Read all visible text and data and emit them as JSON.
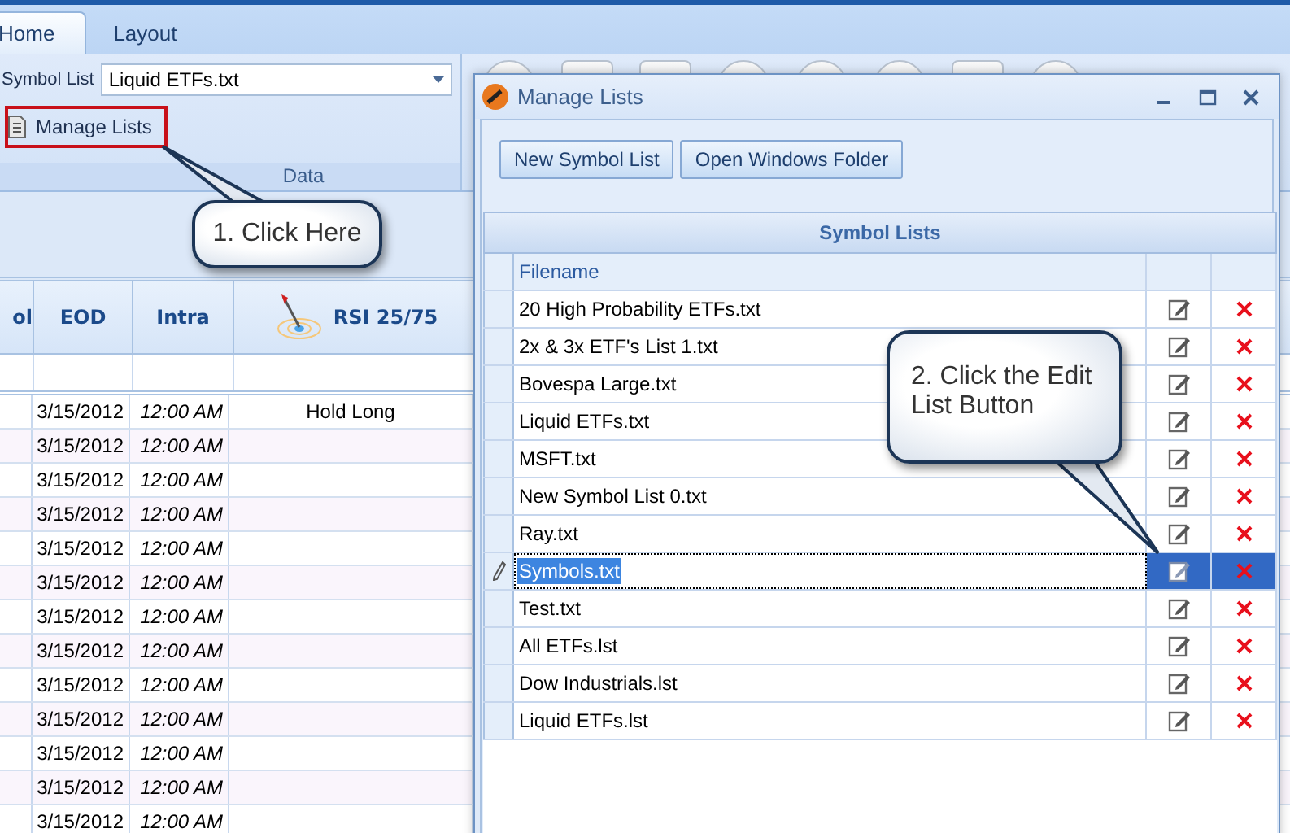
{
  "tabs": [
    {
      "label": "Home",
      "selected": true
    },
    {
      "label": "Layout",
      "selected": false
    }
  ],
  "ribbon": {
    "symbol_list_label": "Symbol List",
    "symbol_list_value": "Liquid ETFs.txt",
    "manage_lists": "Manage Lists",
    "group_label": "Data"
  },
  "grid": {
    "columns": [
      "ol",
      "EOD",
      "Intra",
      "RSI 25/75"
    ],
    "rows": [
      {
        "eod": "3/15/2012",
        "intra": "12:00 AM",
        "signal": "Hold Long"
      },
      {
        "eod": "3/15/2012",
        "intra": "12:00 AM"
      },
      {
        "eod": "3/15/2012",
        "intra": "12:00 AM"
      },
      {
        "eod": "3/15/2012",
        "intra": "12:00 AM"
      },
      {
        "eod": "3/15/2012",
        "intra": "12:00 AM"
      },
      {
        "eod": "3/15/2012",
        "intra": "12:00 AM"
      },
      {
        "eod": "3/15/2012",
        "intra": "12:00 AM"
      },
      {
        "eod": "3/15/2012",
        "intra": "12:00 AM"
      },
      {
        "eod": "3/15/2012",
        "intra": "12:00 AM"
      },
      {
        "eod": "3/15/2012",
        "intra": "12:00 AM"
      },
      {
        "eod": "3/15/2012",
        "intra": "12:00 AM"
      },
      {
        "eod": "3/15/2012",
        "intra": "12:00 AM"
      },
      {
        "eod": "3/15/2012",
        "intra": "12:00 AM"
      }
    ]
  },
  "dialog": {
    "title": "Manage Lists",
    "buttons": [
      "New Symbol List",
      "Open Windows Folder"
    ],
    "panel_title": "Symbol Lists",
    "column": "Filename",
    "rows": [
      {
        "filename": "20 High Probability ETFs.txt",
        "selected": false
      },
      {
        "filename": "2x & 3x ETF's List 1.txt",
        "selected": false
      },
      {
        "filename": "Bovespa Large.txt",
        "selected": false
      },
      {
        "filename": "Liquid ETFs.txt",
        "selected": false
      },
      {
        "filename": "MSFT.txt",
        "selected": false
      },
      {
        "filename": "New Symbol List 0.txt",
        "selected": false
      },
      {
        "filename": "Ray.txt",
        "selected": false
      },
      {
        "filename": "Symbols.txt",
        "selected": true
      },
      {
        "filename": "Test.txt",
        "selected": false
      },
      {
        "filename": "All ETFs.lst",
        "selected": false
      },
      {
        "filename": "Dow Industrials.lst",
        "selected": false
      },
      {
        "filename": "Liquid ETFs.lst",
        "selected": false
      }
    ]
  },
  "callouts": [
    {
      "text": "1. Click Here"
    },
    {
      "text": "2. Click the Edit List Button"
    }
  ]
}
